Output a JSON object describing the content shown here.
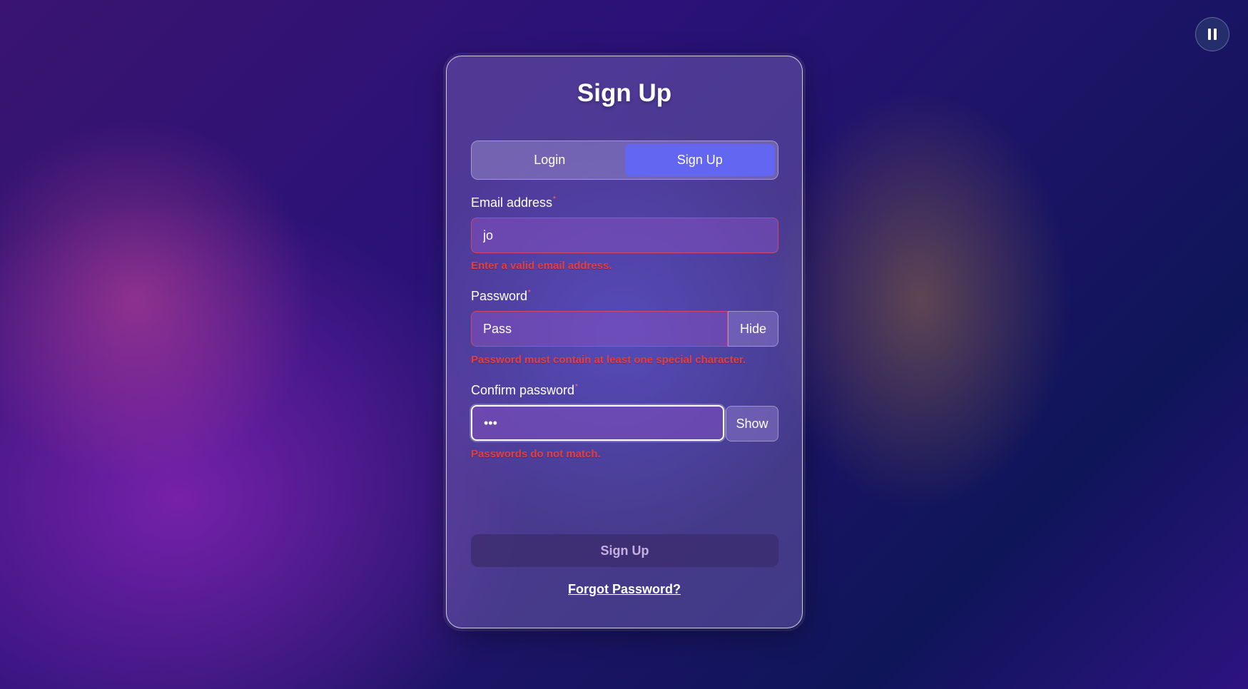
{
  "header": {
    "title": "Sign Up"
  },
  "tabs": [
    {
      "label": "Login",
      "active": false
    },
    {
      "label": "Sign Up",
      "active": true
    }
  ],
  "form": {
    "email": {
      "label": "Email address",
      "required_marker": "*",
      "value": "jo",
      "error": "Enter a valid email address."
    },
    "password": {
      "label": "Password",
      "required_marker": "*",
      "value": "Pass",
      "toggle_label": "Hide",
      "error": "Password must contain at least one special character."
    },
    "confirm_password": {
      "label": "Confirm password",
      "required_marker": "*",
      "value": "•••",
      "toggle_label": "Show",
      "error": "Passwords do not match."
    },
    "submit_label": "Sign Up",
    "forgot_label": "Forgot Password?"
  },
  "controls": {
    "pause_icon": "pause-icon"
  },
  "colors": {
    "accent": "#6366f1",
    "error": "#e53e3e"
  }
}
